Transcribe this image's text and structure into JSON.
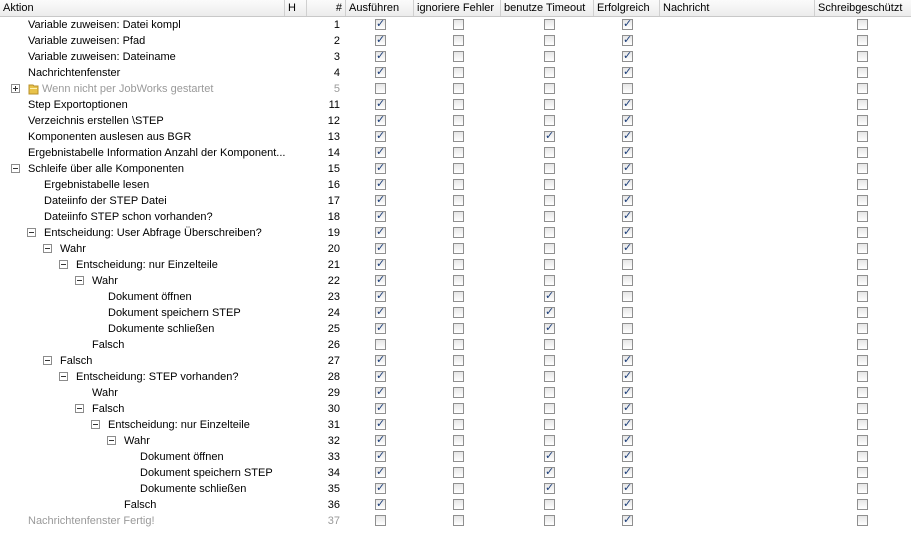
{
  "columns": {
    "aktion": "Aktion",
    "h": "H",
    "num": "#",
    "ausfuehren": "Ausführen",
    "ignoriere": "ignoriere Fehler",
    "timeout": "benutze Timeout",
    "erfolgreich": "Erfolgreich",
    "nachricht": "Nachricht",
    "schreib": "Schreibgeschützt"
  },
  "rows": [
    {
      "label": "Variable zuweisen: Datei kompl",
      "num": "1",
      "level": 0,
      "toggle": "",
      "dimmed": false,
      "icon": "",
      "checks": [
        true,
        false,
        false,
        true,
        false
      ]
    },
    {
      "label": "Variable zuweisen: Pfad",
      "num": "2",
      "level": 0,
      "toggle": "",
      "dimmed": false,
      "icon": "",
      "checks": [
        true,
        false,
        false,
        true,
        false
      ]
    },
    {
      "label": "Variable zuweisen: Dateiname",
      "num": "3",
      "level": 0,
      "toggle": "",
      "dimmed": false,
      "icon": "",
      "checks": [
        true,
        false,
        false,
        true,
        false
      ]
    },
    {
      "label": "Nachrichtenfenster",
      "num": "4",
      "level": 0,
      "toggle": "",
      "dimmed": false,
      "icon": "",
      "checks": [
        true,
        false,
        false,
        true,
        false
      ]
    },
    {
      "label": "Wenn nicht per JobWorks gestartet",
      "num": "5",
      "level": 0,
      "toggle": "plus",
      "dimmed": true,
      "icon": "folder-icon",
      "checks": [
        false,
        false,
        false,
        false,
        false
      ]
    },
    {
      "label": "Step Exportoptionen",
      "num": "11",
      "level": 0,
      "toggle": "",
      "dimmed": false,
      "icon": "",
      "checks": [
        true,
        false,
        false,
        true,
        false
      ]
    },
    {
      "label": "Verzeichnis erstellen \\STEP",
      "num": "12",
      "level": 0,
      "toggle": "",
      "dimmed": false,
      "icon": "",
      "checks": [
        true,
        false,
        false,
        true,
        false
      ]
    },
    {
      "label": "Komponenten auslesen aus BGR",
      "num": "13",
      "level": 0,
      "toggle": "",
      "dimmed": false,
      "icon": "",
      "checks": [
        true,
        false,
        true,
        true,
        false
      ]
    },
    {
      "label": "Ergebnistabelle Information Anzahl der Komponent...",
      "num": "14",
      "level": 0,
      "toggle": "",
      "dimmed": false,
      "icon": "",
      "checks": [
        true,
        false,
        false,
        true,
        false
      ]
    },
    {
      "label": "Schleife über alle Komponenten",
      "num": "15",
      "level": 0,
      "toggle": "minus",
      "dimmed": false,
      "icon": "",
      "checks": [
        true,
        false,
        false,
        true,
        false
      ]
    },
    {
      "label": "Ergebnistabelle lesen",
      "num": "16",
      "level": 1,
      "toggle": "",
      "dimmed": false,
      "icon": "",
      "checks": [
        true,
        false,
        false,
        true,
        false
      ]
    },
    {
      "label": "Dateiinfo der STEP Datei",
      "num": "17",
      "level": 1,
      "toggle": "",
      "dimmed": false,
      "icon": "",
      "checks": [
        true,
        false,
        false,
        true,
        false
      ]
    },
    {
      "label": "Dateiinfo STEP schon vorhanden?",
      "num": "18",
      "level": 1,
      "toggle": "",
      "dimmed": false,
      "icon": "",
      "checks": [
        true,
        false,
        false,
        true,
        false
      ]
    },
    {
      "label": "Entscheidung: User Abfrage Überschreiben?",
      "num": "19",
      "level": 1,
      "toggle": "minus",
      "dimmed": false,
      "icon": "",
      "checks": [
        true,
        false,
        false,
        true,
        false
      ]
    },
    {
      "label": "Wahr",
      "num": "20",
      "level": 2,
      "toggle": "minus",
      "dimmed": false,
      "icon": "",
      "checks": [
        true,
        false,
        false,
        true,
        false
      ]
    },
    {
      "label": "Entscheidung: nur Einzelteile",
      "num": "21",
      "level": 3,
      "toggle": "minus",
      "dimmed": false,
      "icon": "",
      "checks": [
        true,
        false,
        false,
        false,
        false
      ]
    },
    {
      "label": "Wahr",
      "num": "22",
      "level": 4,
      "toggle": "minus",
      "dimmed": false,
      "icon": "",
      "checks": [
        true,
        false,
        false,
        false,
        false
      ]
    },
    {
      "label": "Dokument öffnen",
      "num": "23",
      "level": 5,
      "toggle": "",
      "dimmed": false,
      "icon": "",
      "checks": [
        true,
        false,
        true,
        false,
        false
      ]
    },
    {
      "label": "Dokument speichern STEP",
      "num": "24",
      "level": 5,
      "toggle": "",
      "dimmed": false,
      "icon": "",
      "checks": [
        true,
        false,
        true,
        false,
        false
      ]
    },
    {
      "label": "Dokumente schließen",
      "num": "25",
      "level": 5,
      "toggle": "",
      "dimmed": false,
      "icon": "",
      "checks": [
        true,
        false,
        true,
        false,
        false
      ]
    },
    {
      "label": "Falsch",
      "num": "26",
      "level": 4,
      "toggle": "",
      "dimmed": false,
      "icon": "",
      "checks": [
        false,
        false,
        false,
        false,
        false
      ]
    },
    {
      "label": "Falsch",
      "num": "27",
      "level": 2,
      "toggle": "minus",
      "dimmed": false,
      "icon": "",
      "checks": [
        true,
        false,
        false,
        true,
        false
      ]
    },
    {
      "label": "Entscheidung: STEP vorhanden?",
      "num": "28",
      "level": 3,
      "toggle": "minus",
      "dimmed": false,
      "icon": "",
      "checks": [
        true,
        false,
        false,
        true,
        false
      ]
    },
    {
      "label": "Wahr",
      "num": "29",
      "level": 4,
      "toggle": "",
      "dimmed": false,
      "icon": "",
      "checks": [
        true,
        false,
        false,
        true,
        false
      ]
    },
    {
      "label": "Falsch",
      "num": "30",
      "level": 4,
      "toggle": "minus",
      "dimmed": false,
      "icon": "",
      "checks": [
        true,
        false,
        false,
        true,
        false
      ]
    },
    {
      "label": "Entscheidung: nur Einzelteile",
      "num": "31",
      "level": 5,
      "toggle": "minus",
      "dimmed": false,
      "icon": "",
      "checks": [
        true,
        false,
        false,
        true,
        false
      ]
    },
    {
      "label": "Wahr",
      "num": "32",
      "level": 6,
      "toggle": "minus",
      "dimmed": false,
      "icon": "",
      "checks": [
        true,
        false,
        false,
        true,
        false
      ]
    },
    {
      "label": "Dokument öffnen",
      "num": "33",
      "level": 7,
      "toggle": "",
      "dimmed": false,
      "icon": "",
      "checks": [
        true,
        false,
        true,
        true,
        false
      ]
    },
    {
      "label": "Dokument speichern STEP",
      "num": "34",
      "level": 7,
      "toggle": "",
      "dimmed": false,
      "icon": "",
      "checks": [
        true,
        false,
        true,
        true,
        false
      ]
    },
    {
      "label": "Dokumente schließen",
      "num": "35",
      "level": 7,
      "toggle": "",
      "dimmed": false,
      "icon": "",
      "checks": [
        true,
        false,
        true,
        true,
        false
      ]
    },
    {
      "label": "Falsch",
      "num": "36",
      "level": 6,
      "toggle": "",
      "dimmed": false,
      "icon": "",
      "checks": [
        true,
        false,
        false,
        true,
        false
      ]
    },
    {
      "label": "Nachrichtenfenster Fertig!",
      "num": "37",
      "level": 0,
      "toggle": "",
      "dimmed": true,
      "icon": "",
      "checks": [
        false,
        false,
        false,
        true,
        false
      ]
    }
  ]
}
